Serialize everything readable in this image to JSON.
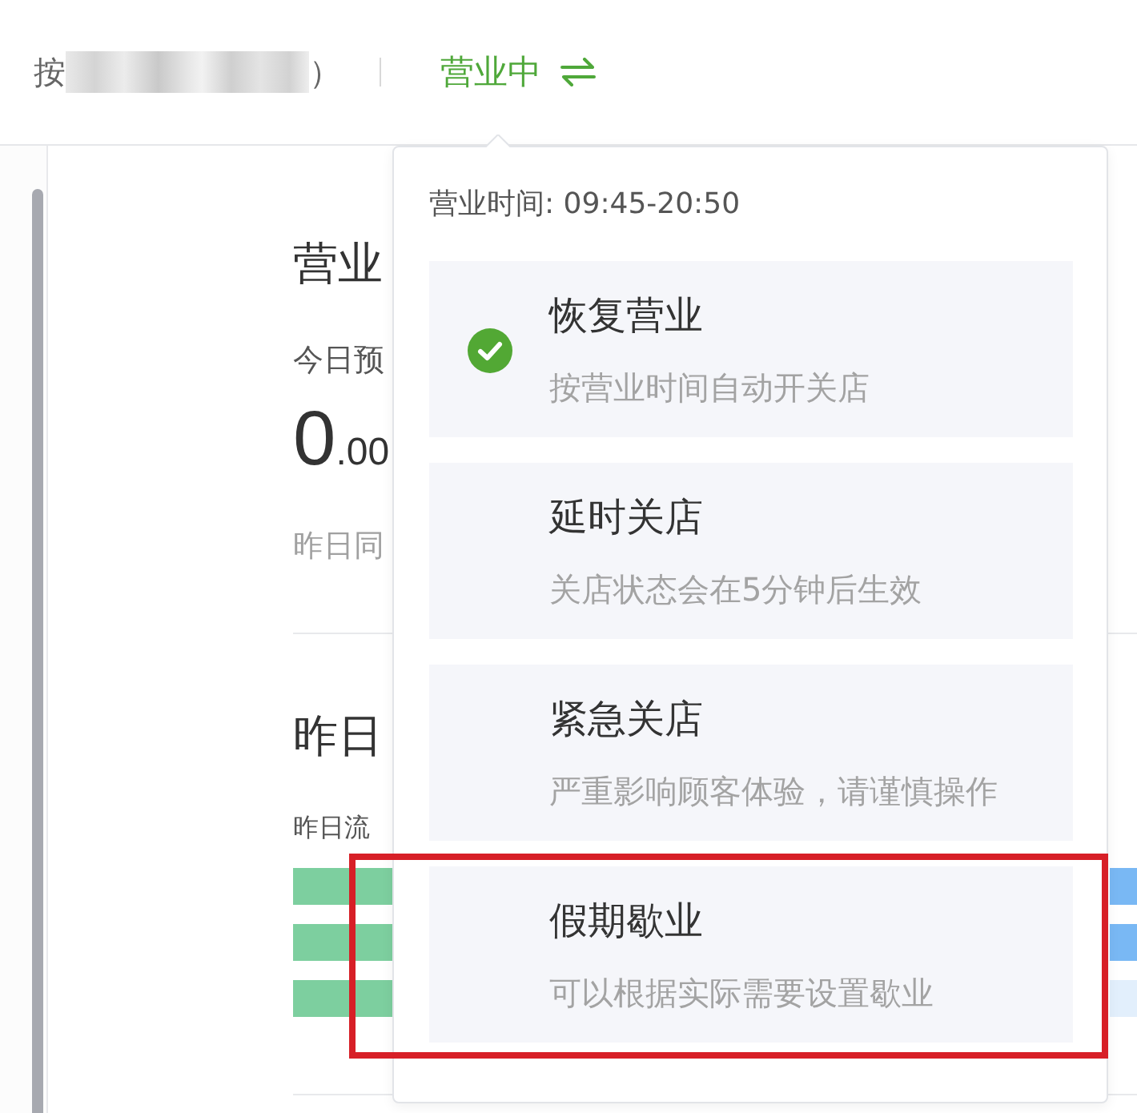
{
  "header": {
    "shop_name_start": "按",
    "shop_name_end": "）",
    "status": "营业中"
  },
  "overview": {
    "title": "营业",
    "today_label": "今日预",
    "amount": {
      "integer": "0",
      "decimal": ".00"
    },
    "compare_label": "昨日同"
  },
  "traffic": {
    "title": "昨日",
    "label": "昨日流"
  },
  "popover": {
    "hours": "营业时间: 09:45-20:50",
    "options": [
      {
        "title": "恢复营业",
        "description": "按营业时间自动开关店",
        "selected": true,
        "highlighted": false
      },
      {
        "title": "延时关店",
        "description": "关店状态会在5分钟后生效",
        "selected": false,
        "highlighted": false
      },
      {
        "title": "紧急关店",
        "description": "严重影响顾客体验，请谨慎操作",
        "selected": false,
        "highlighted": false
      },
      {
        "title": "假期歇业",
        "description": "可以根据实际需要设置歇业",
        "selected": false,
        "highlighted": true
      }
    ]
  }
}
